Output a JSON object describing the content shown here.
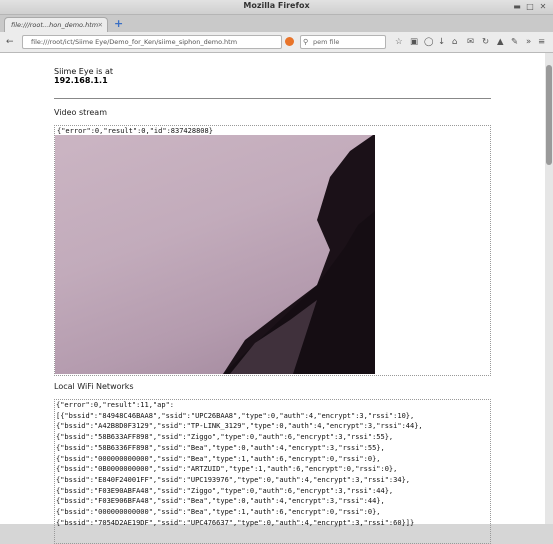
{
  "window": {
    "title": "Mozilla Firefox"
  },
  "tab": {
    "label": "file:///root...hon_demo.htm"
  },
  "toolbar": {
    "url": "file:///root/ict/Siime Eye/Demo_for_Ken/siime_siphon_demo.htm",
    "search_value": "pem file"
  },
  "page": {
    "status_text": "Siime Eye is at",
    "ip": "192.168.1.1",
    "video_label": "Video stream",
    "video_response": "{\"error\":0,\"result\":0,\"id\":837428808}",
    "wifi_label": "Local WiFi Networks",
    "wifi_lines": [
      "{\"error\":0,\"result\":11,\"ap\":",
      "[{\"bssid\":\"84948C46BAA8\",\"ssid\":\"UPC26BAA8\",\"type\":0,\"auth\":4,\"encrypt\":3,\"rssi\":10},",
      "{\"bssid\":\"A42B8D0F3129\",\"ssid\":\"TP-LINK_3129\",\"type\":0,\"auth\":4,\"encrypt\":3,\"rssi\":44},",
      "{\"bssid\":\"58B633AFF898\",\"ssid\":\"Ziggo\",\"type\":0,\"auth\":6,\"encrypt\":3,\"rssi\":55},",
      "{\"bssid\":\"58B6336FF898\",\"ssid\":\"Bea\",\"type\":0,\"auth\":4,\"encrypt\":3,\"rssi\":55},",
      "{\"bssid\":\"000000000000\",\"ssid\":\"Bea\",\"type\":1,\"auth\":6,\"encrypt\":0,\"rssi\":0},",
      "{\"bssid\":\"0B0000000000\",\"ssid\":\"ARTZUID\",\"type\":1,\"auth\":6,\"encrypt\":0,\"rssi\":0},",
      "{\"bssid\":\"E840F24001FF\",\"ssid\":\"UPC193976\",\"type\":0,\"auth\":4,\"encrypt\":3,\"rssi\":34},",
      "{\"bssid\":\"F03E90ABFA48\",\"ssid\":\"Ziggo\",\"type\":0,\"auth\":6,\"encrypt\":3,\"rssi\":44},",
      "{\"bssid\":\"F03E906BFA48\",\"ssid\":\"Bea\",\"type\":0,\"auth\":4,\"encrypt\":3,\"rssi\":44},",
      "{\"bssid\":\"000000000000\",\"ssid\":\"Bea\",\"type\":1,\"auth\":6,\"encrypt\":0,\"rssi\":0},",
      "{\"bssid\":\"7054D2AE19DF\",\"ssid\":\"UPC476637\",\"type\":0,\"auth\":4,\"encrypt\":3,\"rssi\":60}]}"
    ]
  }
}
